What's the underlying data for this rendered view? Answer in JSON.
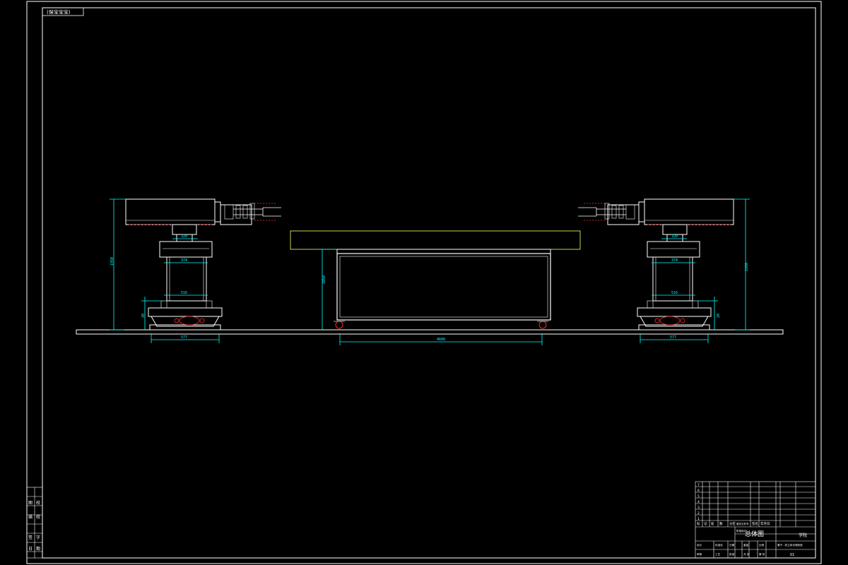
{
  "corner_tag": "(保宝宝宝)",
  "dimensions": {
    "left_height": "1950",
    "left_base_h": "20",
    "left_top_w": "320",
    "left_mid_w": "374",
    "left_low_w": "516",
    "left_base_w": "577",
    "table_height": "1050",
    "table_width": "4600",
    "right_height": "2260",
    "right_base_h": "20",
    "right_top_w": "320",
    "right_mid_w": "374",
    "right_low_w": "516",
    "right_base_w": "577"
  },
  "left_strip": {
    "cells": [
      "图",
      "校",
      "描",
      "校",
      "签",
      "字",
      "日",
      "期"
    ]
  },
  "title_block": {
    "revision_rows": [
      "7",
      "6",
      "5",
      "4",
      "3",
      "2",
      "1"
    ],
    "header_labels": [
      "标",
      "记",
      "处",
      "数",
      "分区",
      "更改文件号",
      "签名",
      "年月日"
    ],
    "drawing_title": "总体图",
    "company": "学院",
    "project": "基于...的立体仓储系统",
    "sheet": "01",
    "bottom_labels": [
      "设计",
      "标准化",
      "审核",
      "工艺",
      "批准",
      "日期"
    ],
    "scale_labels": [
      "阶段标记",
      "重量",
      "比例",
      "共 张",
      "第 张"
    ]
  }
}
